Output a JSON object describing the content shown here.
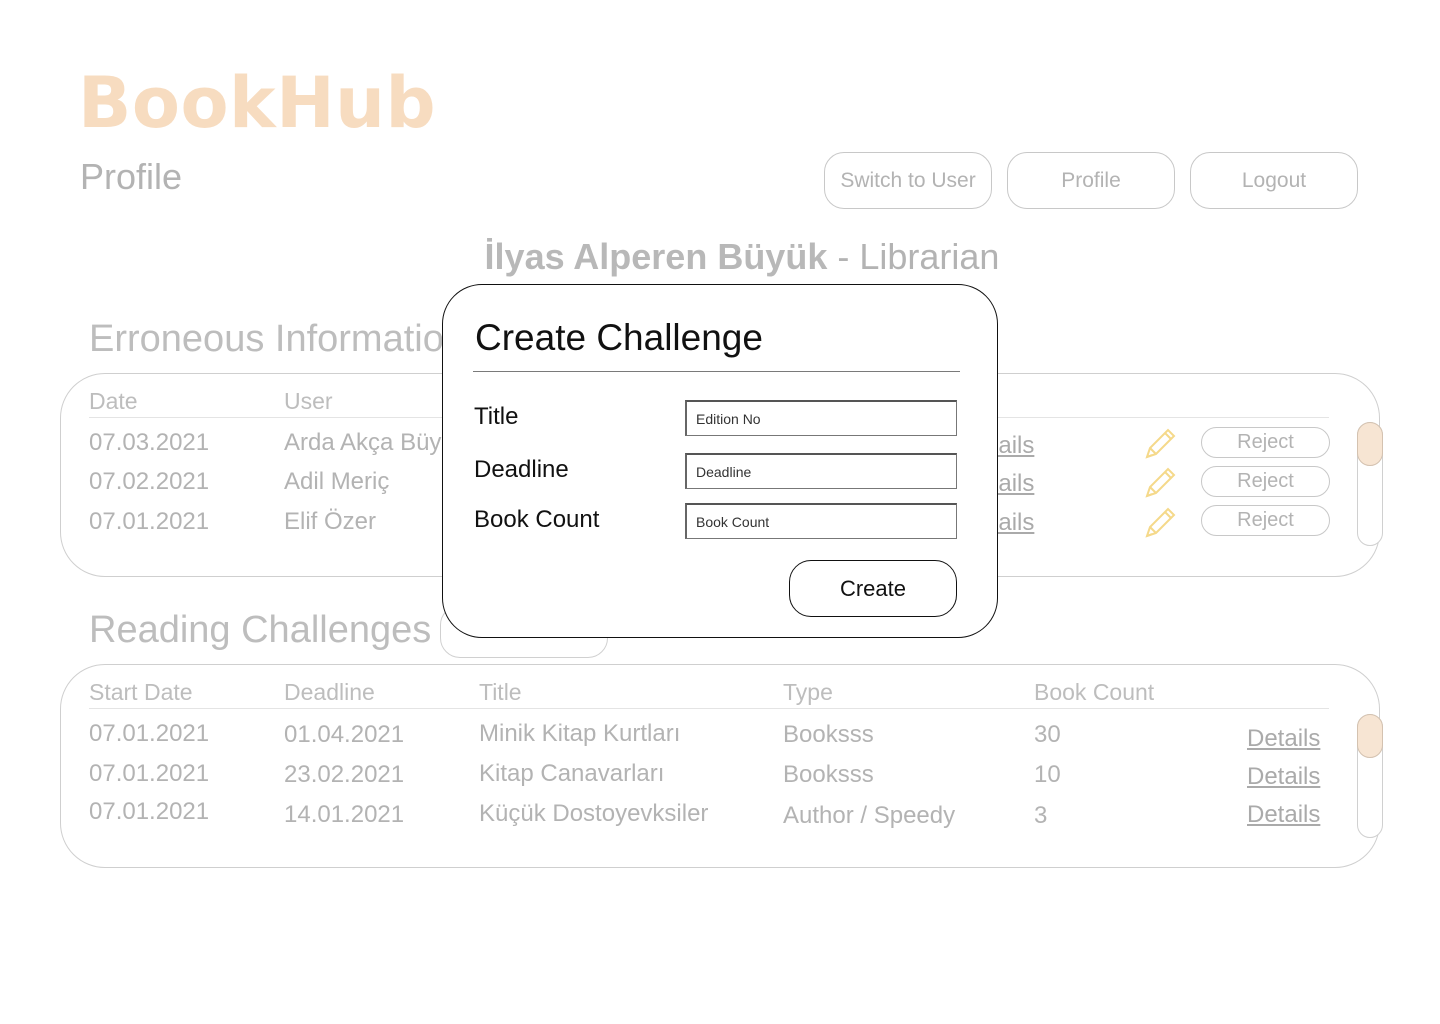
{
  "app": {
    "logo": "BookHub",
    "page_title": "Profile"
  },
  "header": {
    "switch_user": "Switch to User",
    "profile": "Profile",
    "logout": "Logout"
  },
  "user": {
    "name": "İlyas Alperen Büyük",
    "separator": " - ",
    "role": "Librarian"
  },
  "erroneous": {
    "title": "Erroneous Information",
    "headers": {
      "date": "Date",
      "user": "User"
    },
    "rows": [
      {
        "date": "07.03.2021",
        "user": "Arda Akça Büyük",
        "link": "Details",
        "action": "Reject"
      },
      {
        "date": "07.02.2021",
        "user": "Adil Meriç",
        "link": "Details",
        "action": "Reject"
      },
      {
        "date": "07.01.2021",
        "user": "Elif Özer",
        "link": "Details",
        "action": "Reject"
      }
    ]
  },
  "challenges": {
    "title": "Reading Challenges",
    "headers": {
      "start": "Start Date",
      "deadline": "Deadline",
      "title": "Title",
      "type": "Type",
      "count": "Book Count"
    },
    "rows": [
      {
        "start": "07.01.2021",
        "deadline": "01.04.2021",
        "title": "Minik Kitap Kurtları",
        "type": "Booksss",
        "count": "30",
        "link": "Details"
      },
      {
        "start": "07.01.2021",
        "deadline": "23.02.2021",
        "title": "Kitap Canavarları",
        "type": "Booksss",
        "count": "10",
        "link": "Details"
      },
      {
        "start": "07.01.2021",
        "deadline": "14.01.2021",
        "title": "Küçük Dostoyevksiler",
        "type": "Author / Speedy",
        "count": "3",
        "link": "Details"
      }
    ]
  },
  "modal": {
    "title": "Create Challenge",
    "fields": {
      "title_label": "Title",
      "title_placeholder": "Edition No",
      "deadline_label": "Deadline",
      "deadline_placeholder": "Deadline",
      "count_label": "Book Count",
      "count_placeholder": "Book Count"
    },
    "create": "Create"
  },
  "colors": {
    "brand": "#f7dcc0",
    "accent": "#f7e5d3",
    "pencil": "#f5d98a"
  },
  "icons": {
    "edit": "pencil-icon"
  }
}
